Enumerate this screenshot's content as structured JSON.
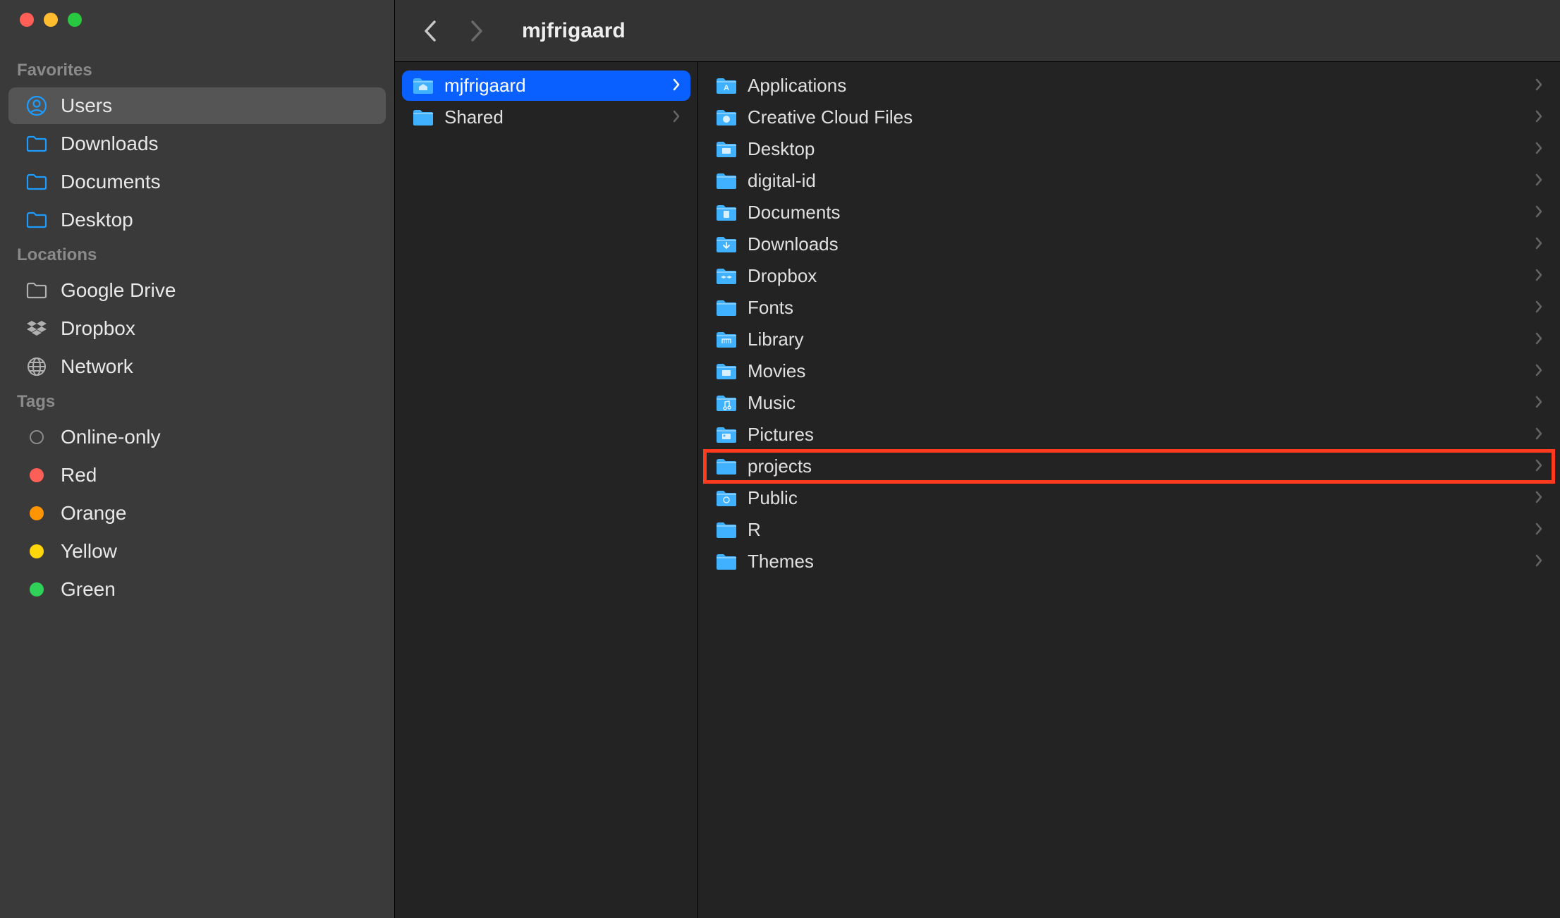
{
  "toolbar": {
    "title": "mjfrigaard"
  },
  "sidebar": {
    "sections": [
      {
        "header": "Favorites",
        "items": [
          {
            "label": "Users",
            "icon": "user-circle-icon",
            "selected": true
          },
          {
            "label": "Downloads",
            "icon": "folder-outline-icon"
          },
          {
            "label": "Documents",
            "icon": "folder-outline-icon"
          },
          {
            "label": "Desktop",
            "icon": "folder-outline-icon"
          }
        ]
      },
      {
        "header": "Locations",
        "items": [
          {
            "label": "Google Drive",
            "icon": "drive-icon"
          },
          {
            "label": "Dropbox",
            "icon": "dropbox-icon"
          },
          {
            "label": "Network",
            "icon": "globe-icon"
          }
        ]
      },
      {
        "header": "Tags",
        "items": [
          {
            "label": "Online-only",
            "tagColor": "outline"
          },
          {
            "label": "Red",
            "tagColor": "#ff5f57"
          },
          {
            "label": "Orange",
            "tagColor": "#ff9500"
          },
          {
            "label": "Yellow",
            "tagColor": "#ffd60a"
          },
          {
            "label": "Green",
            "tagColor": "#30d158"
          }
        ]
      }
    ]
  },
  "columns": [
    {
      "items": [
        {
          "label": "mjfrigaard",
          "icon": "home-folder-icon",
          "selected": true,
          "hasChildren": true
        },
        {
          "label": "Shared",
          "icon": "folder-icon",
          "hasChildren": true
        }
      ]
    },
    {
      "items": [
        {
          "label": "Applications",
          "icon": "app-folder-icon",
          "hasChildren": true
        },
        {
          "label": "Creative Cloud Files",
          "icon": "cc-folder-icon",
          "hasChildren": true
        },
        {
          "label": "Desktop",
          "icon": "desktop-folder-icon",
          "hasChildren": true
        },
        {
          "label": "digital-id",
          "icon": "folder-icon",
          "hasChildren": true
        },
        {
          "label": "Documents",
          "icon": "documents-folder-icon",
          "hasChildren": true
        },
        {
          "label": "Downloads",
          "icon": "downloads-folder-icon",
          "hasChildren": true
        },
        {
          "label": "Dropbox",
          "icon": "dropbox-folder-icon",
          "hasChildren": true
        },
        {
          "label": "Fonts",
          "icon": "folder-icon",
          "hasChildren": true
        },
        {
          "label": "Library",
          "icon": "library-folder-icon",
          "hasChildren": true
        },
        {
          "label": "Movies",
          "icon": "movies-folder-icon",
          "hasChildren": true
        },
        {
          "label": "Music",
          "icon": "music-folder-icon",
          "hasChildren": true
        },
        {
          "label": "Pictures",
          "icon": "pictures-folder-icon",
          "hasChildren": true
        },
        {
          "label": "projects",
          "icon": "folder-icon",
          "hasChildren": true,
          "highlighted": true
        },
        {
          "label": "Public",
          "icon": "public-folder-icon",
          "hasChildren": true
        },
        {
          "label": "R",
          "icon": "folder-icon",
          "hasChildren": true
        },
        {
          "label": "Themes",
          "icon": "folder-icon",
          "hasChildren": true
        }
      ]
    }
  ]
}
